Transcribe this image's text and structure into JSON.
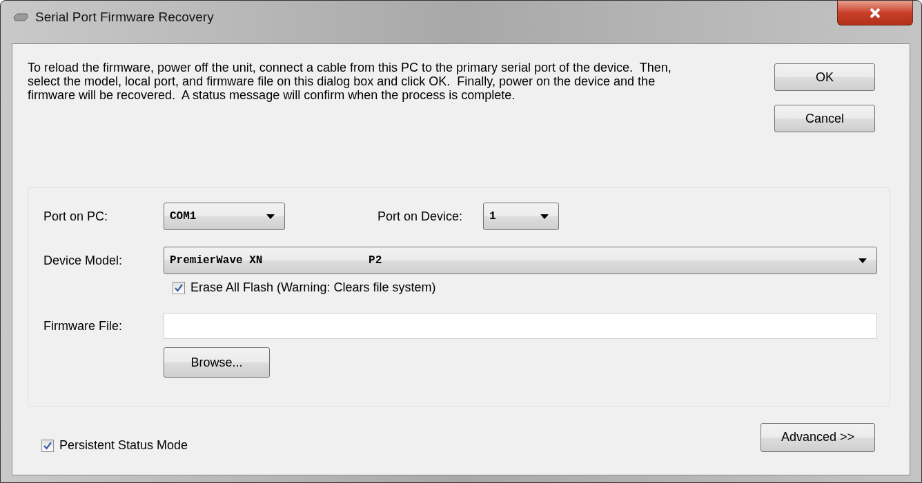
{
  "window": {
    "title": "Serial Port Firmware Recovery"
  },
  "description": "To reload the firmware, power off the unit, connect a cable from this PC to the primary serial port of the device.  Then, select the model, local port, and firmware file on this dialog box and click OK.  Finally, power on the device and the firmware will be recovered.  A status message will confirm when the process is complete.",
  "side_buttons": [
    "OK",
    "Cancel"
  ],
  "port_on_pc": {
    "label": "Port on PC:",
    "value": "COM1"
  },
  "port_on_device": {
    "label": "Port on Device:",
    "value": "1"
  },
  "device_model": {
    "label": "Device Model:",
    "value": "PremierWave XN                P2"
  },
  "erase_all_flash": {
    "label": "Erase All Flash (Warning: Clears file system)",
    "checked": true
  },
  "firmware_file": {
    "label": "Firmware File:"
  },
  "browse_button": "Browse...",
  "persistent_status_mode": {
    "label": "Persistent Status Mode",
    "checked": true
  },
  "advanced_button": "Advanced >>"
}
